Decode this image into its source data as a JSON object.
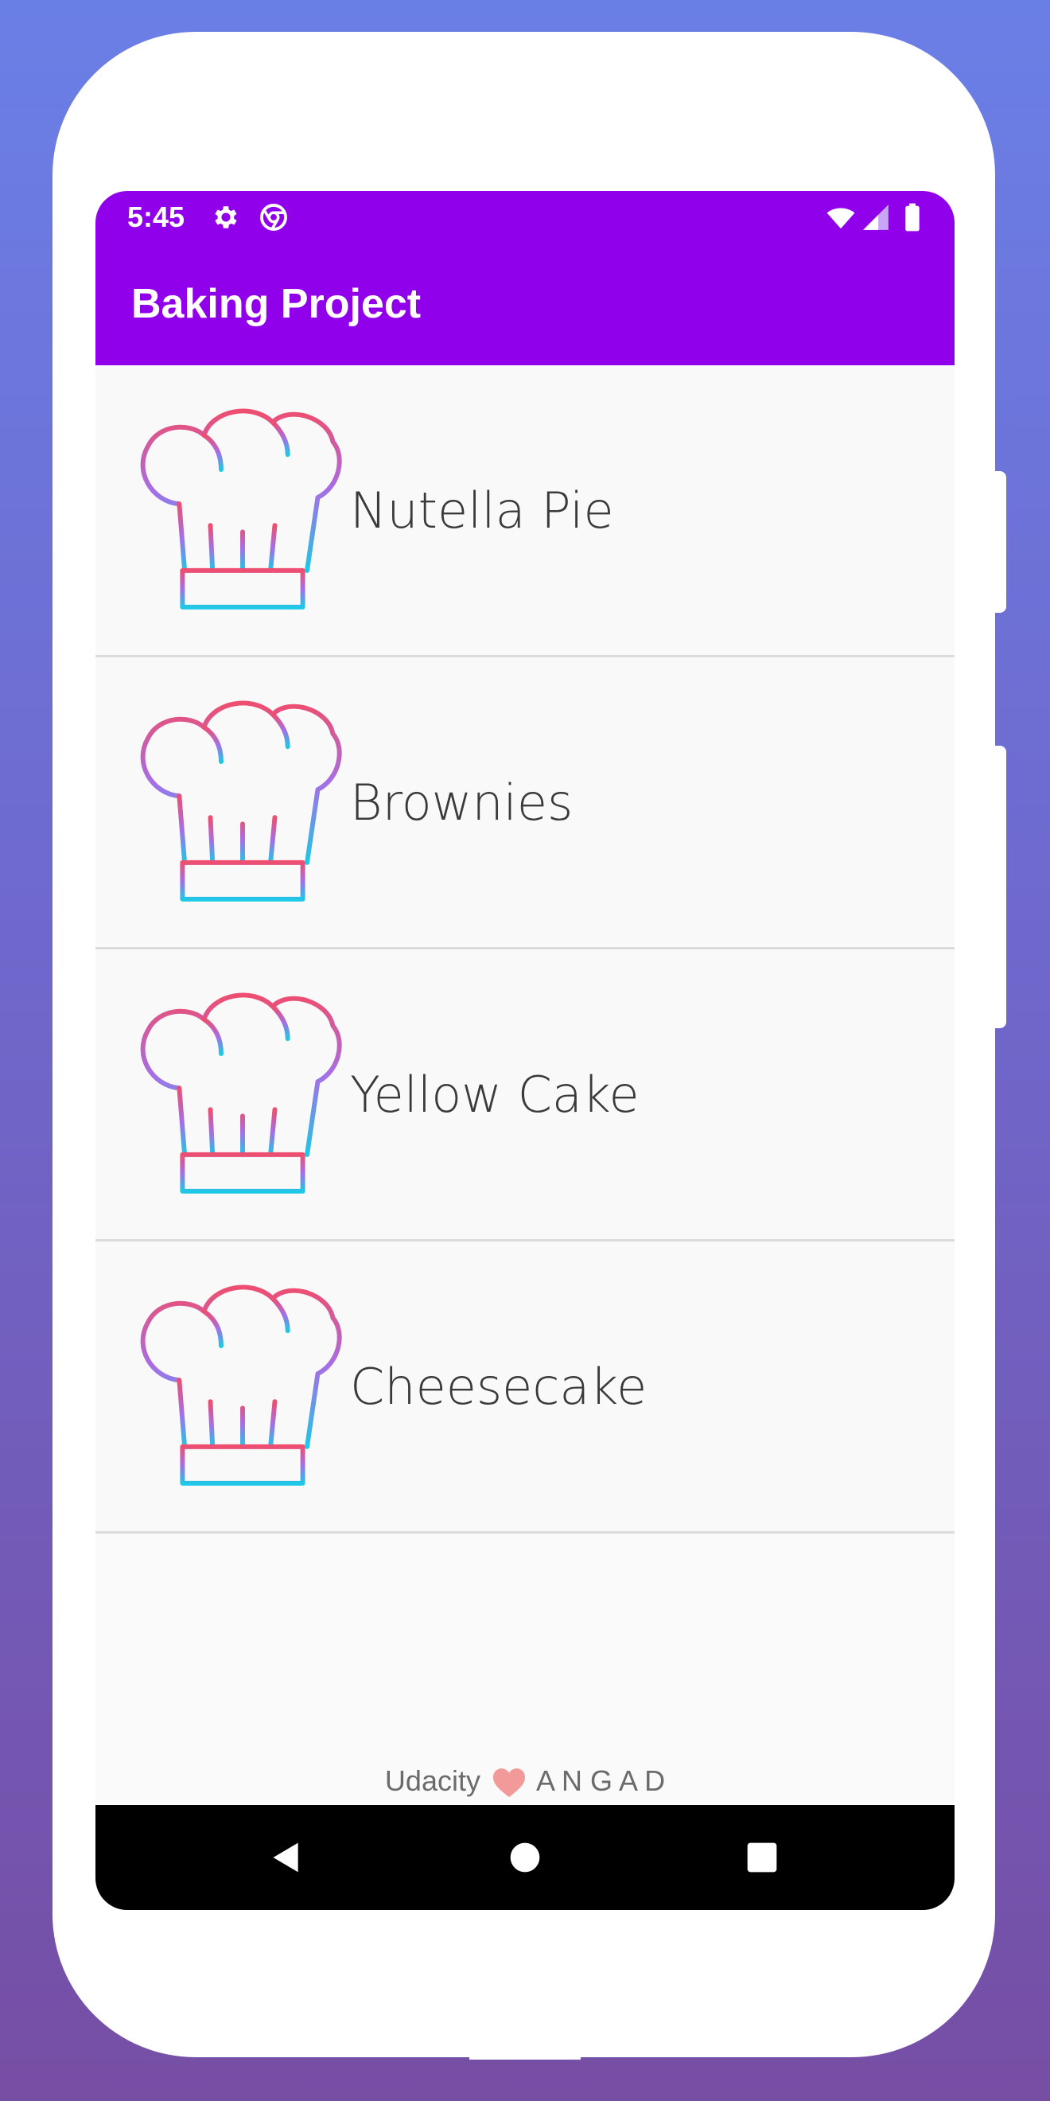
{
  "status_bar": {
    "time": "5:45",
    "left_icons": [
      "settings-icon",
      "chrome-icon"
    ],
    "right_icons": [
      "wifi-icon",
      "cell-signal-icon",
      "battery-icon"
    ]
  },
  "app_bar": {
    "title": "Baking Project",
    "background_color": "#9100ea"
  },
  "recipes": [
    {
      "name": "Nutella Pie",
      "icon": "chef-hat-icon"
    },
    {
      "name": "Brownies",
      "icon": "chef-hat-icon"
    },
    {
      "name": "Yellow Cake",
      "icon": "chef-hat-icon"
    },
    {
      "name": "Cheesecake",
      "icon": "chef-hat-icon"
    }
  ],
  "footer": {
    "left": "Udacity",
    "icon": "heart-icon",
    "right": "A N G A D"
  },
  "nav_bar": {
    "buttons": [
      "back-icon",
      "home-icon",
      "recents-icon"
    ]
  },
  "colors": {
    "hat_gradient_top": "#ee4e6f",
    "hat_gradient_mid": "#a66ee6",
    "hat_gradient_bottom": "#1ec8e6",
    "heart": "#f29a9a"
  }
}
